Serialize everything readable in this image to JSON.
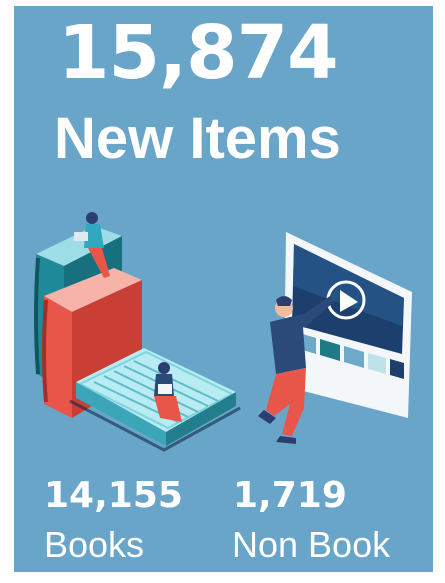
{
  "headline": {
    "total": "15,874",
    "label": "New Items"
  },
  "stats": [
    {
      "value": "14,155",
      "label": "Books"
    },
    {
      "value": "1,719",
      "label": "Non Book"
    }
  ],
  "colors": {
    "background": "#69a5c9",
    "text": "#ffffff",
    "book_teal": "#1f8a9a",
    "book_red": "#e8564a",
    "book_light": "#7fd3df",
    "screen_dark": "#1d3f6e"
  },
  "illustration": {
    "icons": [
      "stacked-books-icon",
      "reader-person-icon",
      "video-screen-icon",
      "play-icon",
      "standing-person-icon"
    ]
  }
}
